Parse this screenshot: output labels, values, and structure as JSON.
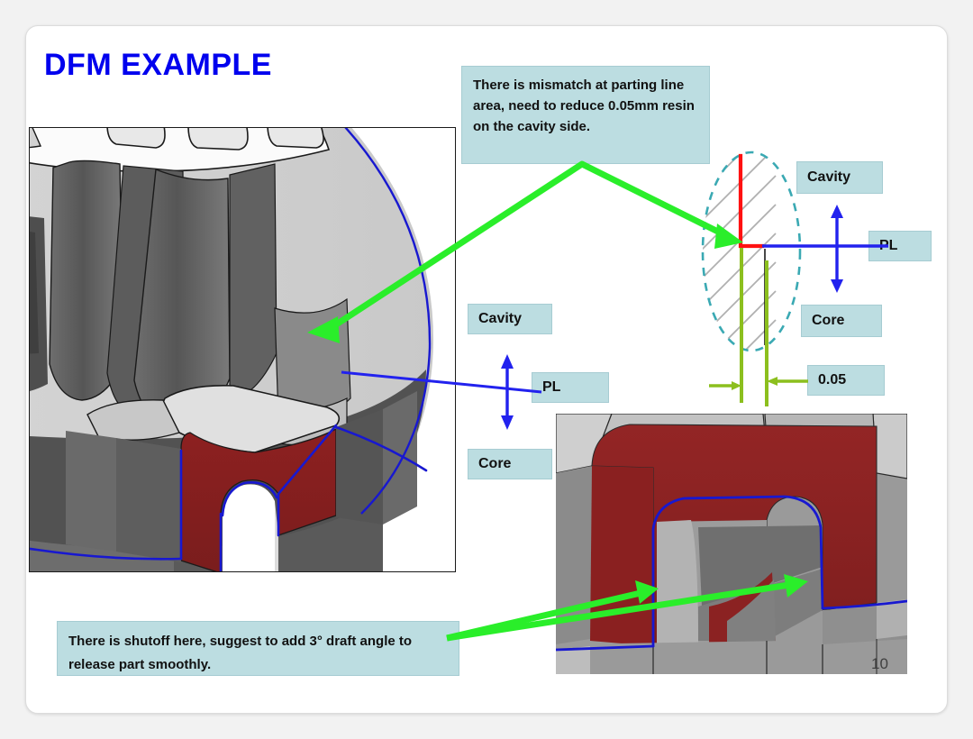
{
  "slide": {
    "title": "DFM EXAMPLE",
    "page_number": "10",
    "title_color": "#0000ee",
    "accent_box_color": "#bcdde1",
    "parting_line_color": "#1818d0",
    "arrow_color": "#2aee2a",
    "dimension_color": "#8cbf1e",
    "mismatch_color": "#ff1111",
    "section_ellipse_color": "#3aa9b3",
    "part_red_color": "#8a2222"
  },
  "callouts": {
    "mismatch": "There is mismatch at parting line area, need to reduce 0.05mm resin on the cavity side.",
    "shutoff": "There is shutoff here, suggest to add 3°  draft angle to release part smoothly."
  },
  "left_annotation": {
    "cavity": "Cavity",
    "pl": "PL",
    "core": "Core"
  },
  "right_annotation": {
    "cavity": "Cavity",
    "pl": "PL",
    "core": "Core",
    "dimension": "0.05"
  },
  "images": {
    "main_part": "3d-cad-part-section-view",
    "detail_part": "3d-cad-part-shutoff-closeup",
    "section_diagram": "mold-parting-line-cross-section"
  }
}
